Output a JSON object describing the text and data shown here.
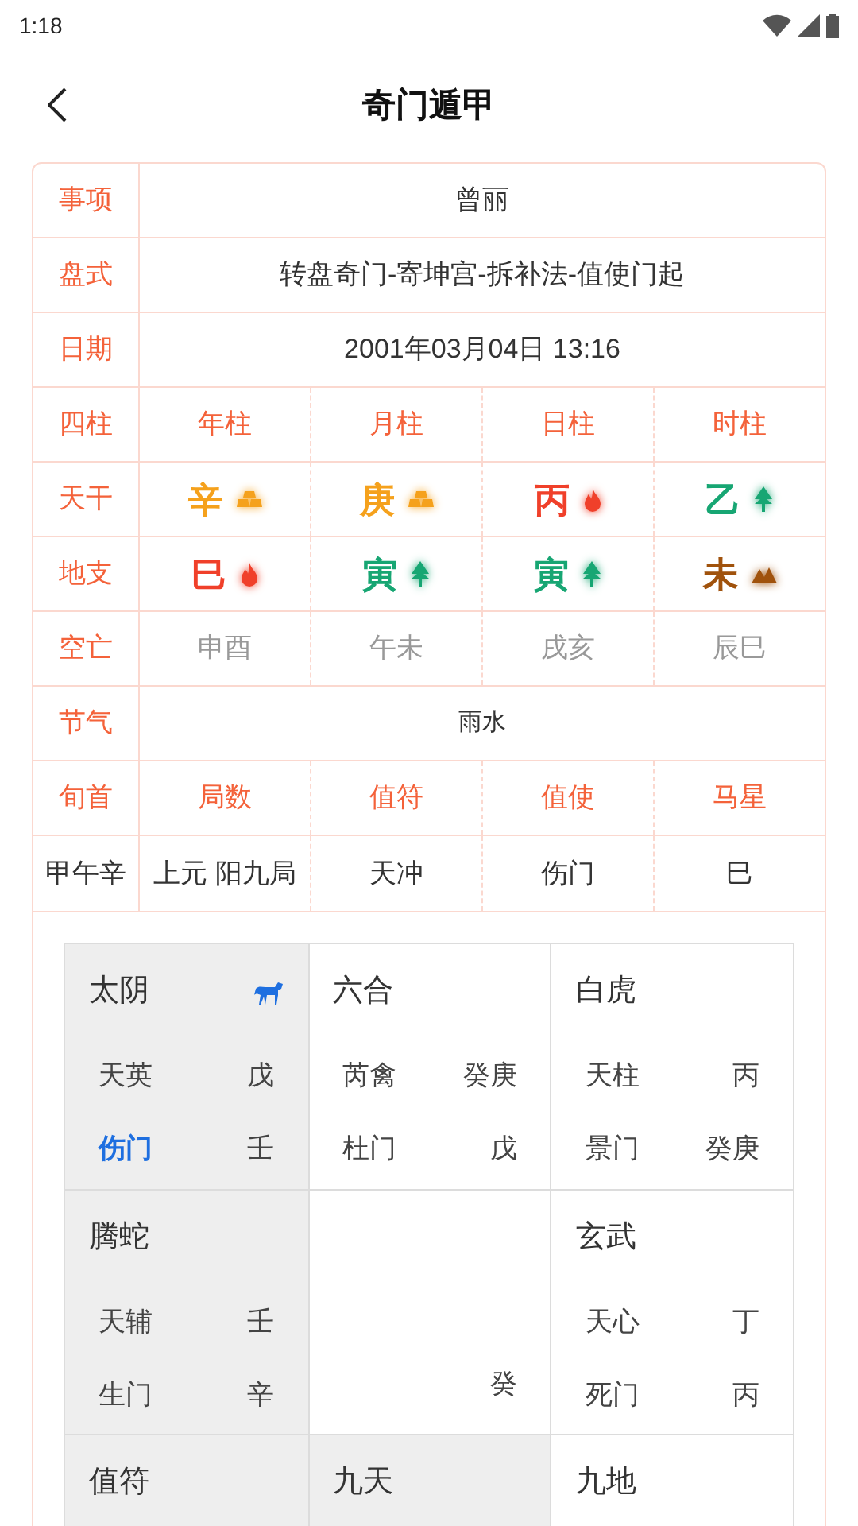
{
  "status_bar": {
    "time": "1:18"
  },
  "header": {
    "title": "奇门遁甲"
  },
  "info": {
    "rows": [
      {
        "label": "事项",
        "value": "曾丽"
      },
      {
        "label": "盘式",
        "value": "转盘奇门-寄坤宫-拆补法-值使门起"
      },
      {
        "label": "日期",
        "value": "2001年03月04日 13:16"
      }
    ]
  },
  "pillars": {
    "label": "四柱",
    "columns": [
      "年柱",
      "月柱",
      "日柱",
      "时柱"
    ]
  },
  "stems": {
    "label": "天干",
    "items": [
      {
        "char": "辛",
        "kind": "metal",
        "color": "#f5a11c"
      },
      {
        "char": "庚",
        "kind": "metal",
        "color": "#f5a11c"
      },
      {
        "char": "丙",
        "kind": "fire",
        "color": "#f0402a"
      },
      {
        "char": "乙",
        "kind": "wood",
        "color": "#17a673"
      }
    ]
  },
  "branches": {
    "label": "地支",
    "items": [
      {
        "char": "巳",
        "kind": "fire",
        "color": "#f0402a"
      },
      {
        "char": "寅",
        "kind": "wood",
        "color": "#17a673"
      },
      {
        "char": "寅",
        "kind": "wood",
        "color": "#17a673"
      },
      {
        "char": "未",
        "kind": "earth",
        "color": "#a0520c"
      }
    ]
  },
  "void": {
    "label": "空亡",
    "values": [
      "申酉",
      "午未",
      "戌亥",
      "辰巳"
    ]
  },
  "solar_term": {
    "label": "节气",
    "value": "雨水"
  },
  "summary": {
    "headers": [
      "旬首",
      "局数",
      "值符",
      "值使",
      "马星"
    ],
    "values": [
      "甲午辛",
      "上元 阳九局",
      "天冲",
      "伤门",
      "巳"
    ]
  },
  "palaces": [
    {
      "deity": "太阴",
      "shaded": true,
      "horse": true,
      "star": {
        "name": "天英",
        "stem": "戊"
      },
      "gate": {
        "name": "伤门",
        "stem": "壬",
        "highlight": true
      }
    },
    {
      "deity": "六合",
      "shaded": false,
      "horse": false,
      "star": {
        "name": "芮禽",
        "stem": "癸庚"
      },
      "gate": {
        "name": "杜门",
        "stem": "戊",
        "highlight": false
      }
    },
    {
      "deity": "白虎",
      "shaded": false,
      "horse": false,
      "star": {
        "name": "天柱",
        "stem": "丙"
      },
      "gate": {
        "name": "景门",
        "stem": "癸庚",
        "highlight": false
      }
    },
    {
      "deity": "腾蛇",
      "shaded": true,
      "horse": false,
      "star": {
        "name": "天辅",
        "stem": "壬"
      },
      "gate": {
        "name": "生门",
        "stem": "辛",
        "highlight": false
      }
    },
    {
      "shaded": false,
      "horse": false,
      "center_stem": "癸"
    },
    {
      "deity": "玄武",
      "shaded": false,
      "horse": false,
      "star": {
        "name": "天心",
        "stem": "丁"
      },
      "gate": {
        "name": "死门",
        "stem": "丙",
        "highlight": false
      }
    },
    {
      "deity": "值符",
      "shaded": true,
      "horse": false
    },
    {
      "deity": "九天",
      "shaded": true,
      "horse": false
    },
    {
      "deity": "九地",
      "shaded": false,
      "horse": false
    }
  ]
}
